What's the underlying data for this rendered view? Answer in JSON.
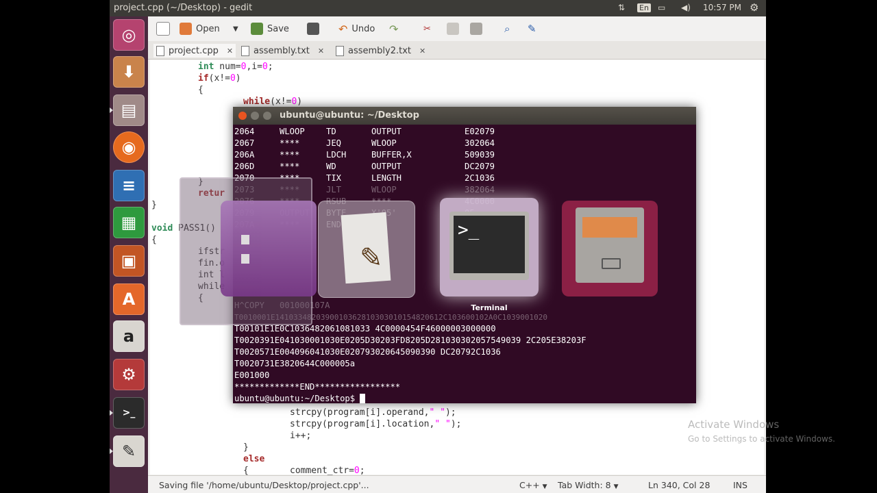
{
  "topbar": {
    "window_title": "project.cpp (~/Desktop) - gedit",
    "keyboard": "En",
    "time": "10:57 PM"
  },
  "launcher": {
    "items": [
      {
        "name": "Dash"
      },
      {
        "name": "Installer"
      },
      {
        "name": "Files"
      },
      {
        "name": "Firefox"
      },
      {
        "name": "Writer"
      },
      {
        "name": "Calc"
      },
      {
        "name": "Impress"
      },
      {
        "name": "Software Center"
      },
      {
        "name": "Amazon"
      },
      {
        "name": "System Settings"
      },
      {
        "name": "Terminal"
      },
      {
        "name": "Text Editor"
      }
    ]
  },
  "toolbar": {
    "open_label": "Open",
    "save_label": "Save",
    "undo_label": "Undo"
  },
  "tabs": [
    {
      "label": "project.cpp"
    },
    {
      "label": "assembly.txt"
    },
    {
      "label": "assembly2.txt"
    }
  ],
  "editor": {
    "lines": [
      "int num=0,i=0;",
      "if(x!=0)",
      "{",
      "while(x!=0)",
      "}",
      "retur",
      "}",
      "void PASS1()",
      "{",
      "ifstr",
      "fin.o",
      "int l",
      "while",
      "{",
      "strcpy(program[i].operand,\" \");",
      "strcpy(program[i].location,\" \");",
      "i++;",
      "}",
      "else",
      "{",
      "comment_ctr=0;"
    ]
  },
  "statusbar": {
    "message": "Saving file '/home/ubuntu/Desktop/project.cpp'...",
    "language": "C++",
    "tab_width": "Tab Width: 8",
    "position": "Ln 340, Col 28",
    "mode": "INS"
  },
  "terminal": {
    "title": "ubuntu@ubuntu: ~/Desktop",
    "table": [
      [
        "2064",
        "WLOOP",
        "TD",
        "OUTPUT",
        "E02079"
      ],
      [
        "2067",
        "****",
        "JEQ",
        "WLOOP",
        "302064"
      ],
      [
        "206A",
        "****",
        "LDCH",
        "BUFFER,X",
        "509039"
      ],
      [
        "206D",
        "****",
        "WD",
        "OUTPUT",
        "DC2079"
      ],
      [
        "2070",
        "****",
        "TIX",
        "LENGTH",
        "2C1036"
      ],
      [
        "2073",
        "****",
        "JLT",
        "WLOOP",
        "382064"
      ],
      [
        "2076",
        "****",
        "RSUB",
        "****",
        "4C0000"
      ],
      [
        "2079",
        "OUTPUT",
        "BYTE",
        "X'05'",
        "05"
      ],
      [
        "207A",
        "****",
        "END",
        "",
        ""
      ]
    ],
    "dim_text": [
      "H^COPY   001000107A",
      "T0010001E1410334820390010362810303010154820612C103600102A0C1039001020"
    ],
    "object_lines": [
      "T00101E1E0C1036482061081033 4C0000454F46000003000000",
      "T0020391E041030001030E0205D30203FD8205D281030302057549039 2C205E38203F",
      "T0020571E004096041030E020793020645090390 DC20792C1036",
      "T0020731E3820644C000005a",
      "E001000",
      "*************END*****************"
    ],
    "prompt": "ubuntu@ubuntu:~/Desktop$"
  },
  "switcher": {
    "selected_label": "Terminal",
    "items": [
      {
        "name": "Files"
      },
      {
        "name": "Text Editor"
      },
      {
        "name": "Terminal"
      },
      {
        "name": "File Cabinet"
      }
    ]
  },
  "watermark": {
    "line1": "Activate Windows",
    "line2": "Go to Settings to activate Windows."
  }
}
